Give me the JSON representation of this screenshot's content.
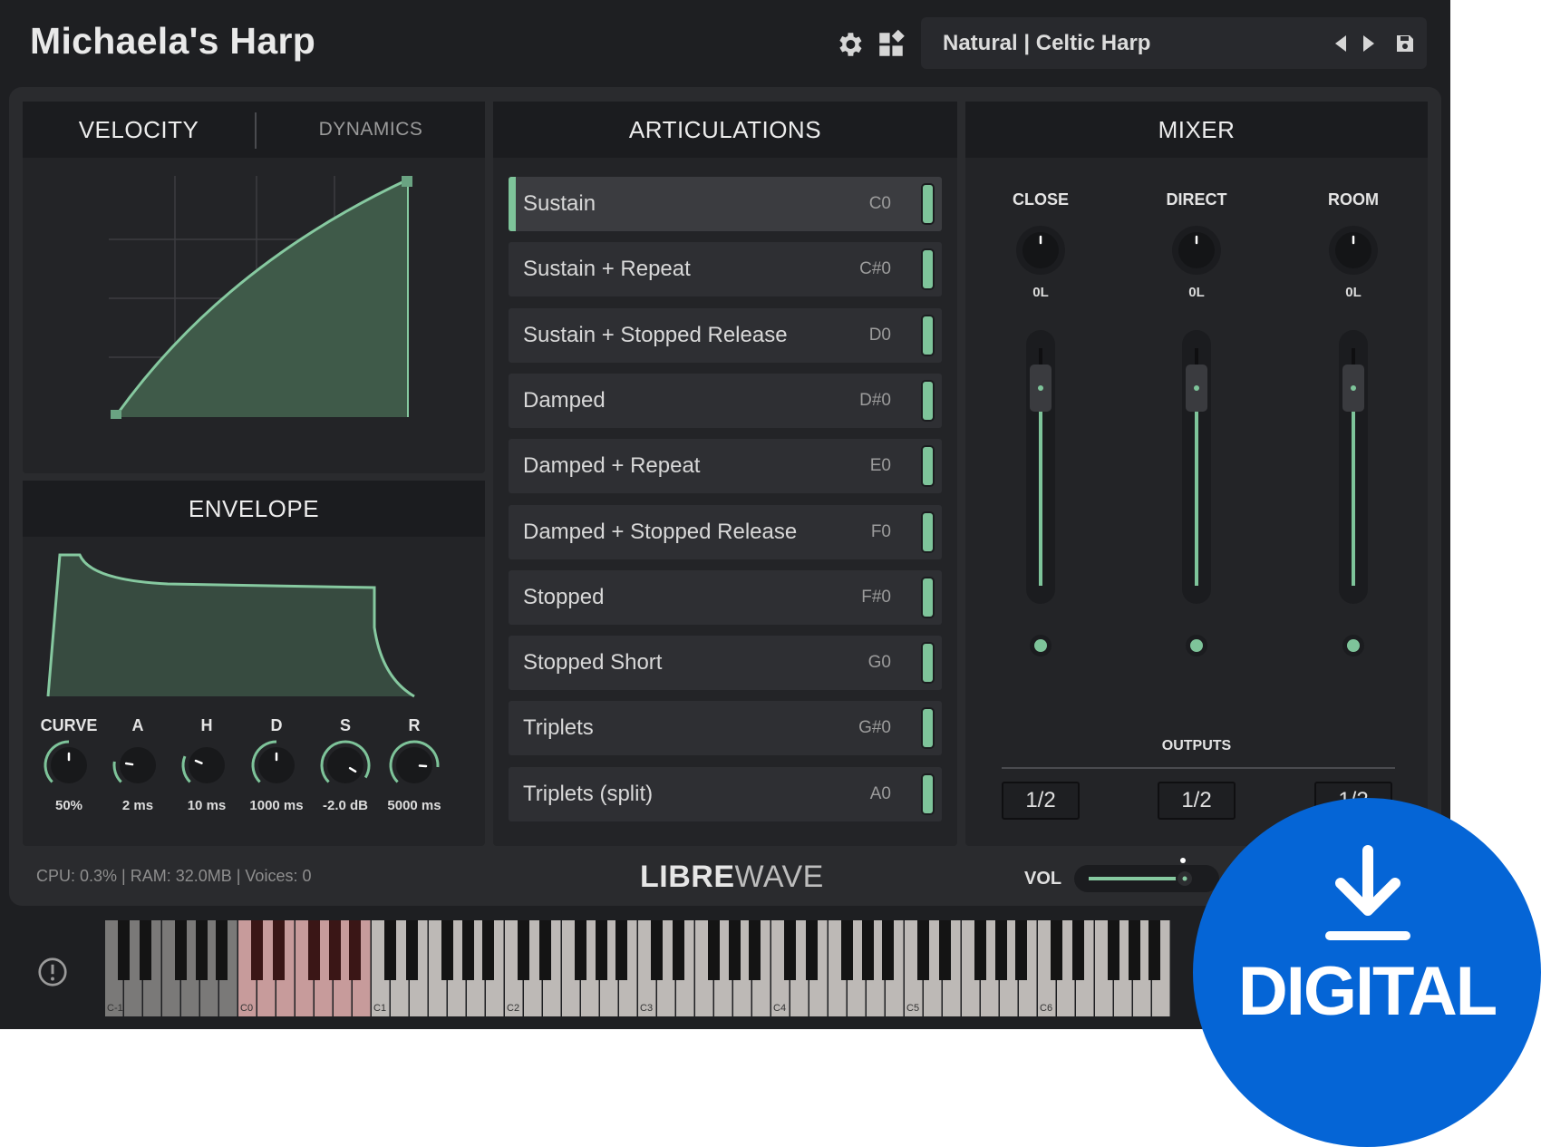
{
  "header": {
    "title": "Michaela's Harp",
    "preset": "Natural | Celtic Harp",
    "icons": [
      "gear-icon",
      "grid-icon",
      "prev-icon",
      "next-icon",
      "save-icon"
    ]
  },
  "velocity_panel": {
    "tab_active": "VELOCITY",
    "tab_inactive": "DYNAMICS"
  },
  "envelope_panel": {
    "title": "ENVELOPE",
    "knobs": [
      {
        "label": "CURVE",
        "value": "50%",
        "level": 0.5
      },
      {
        "label": "A",
        "value": "2 ms",
        "level": 0.2
      },
      {
        "label": "H",
        "value": "10 ms",
        "level": 0.25
      },
      {
        "label": "D",
        "value": "1000 ms",
        "level": 0.5
      },
      {
        "label": "S",
        "value": "-2.0 dB",
        "level": 0.95
      },
      {
        "label": "R",
        "value": "5000 ms",
        "level": 0.85
      }
    ]
  },
  "articulations_panel": {
    "title": "ARTICULATIONS",
    "items": [
      {
        "label": "Sustain",
        "note": "C0",
        "active": true
      },
      {
        "label": "Sustain + Repeat",
        "note": "C#0"
      },
      {
        "label": "Sustain + Stopped Release",
        "note": "D0"
      },
      {
        "label": "Damped",
        "note": "D#0"
      },
      {
        "label": "Damped + Repeat",
        "note": "E0"
      },
      {
        "label": "Damped + Stopped Release",
        "note": "F0"
      },
      {
        "label": "Stopped",
        "note": "F#0"
      },
      {
        "label": "Stopped Short",
        "note": "G0"
      },
      {
        "label": "Triplets",
        "note": "G#0"
      },
      {
        "label": "Triplets (split)",
        "note": "A0"
      }
    ]
  },
  "mixer_panel": {
    "title": "MIXER",
    "channels": [
      {
        "label": "CLOSE",
        "pan": "0L",
        "output": "1/2"
      },
      {
        "label": "DIRECT",
        "pan": "0L",
        "output": "1/2"
      },
      {
        "label": "ROOM",
        "pan": "0L",
        "output": "1/2"
      }
    ],
    "outputs_label": "OUTPUTS"
  },
  "footer": {
    "status": "CPU: 0.3% | RAM: 32.0MB | Voices: 0",
    "logo_bold": "LIBRE",
    "logo_light": "WAVE",
    "vol_label": "VOL"
  },
  "keyboard": {
    "octave_labels": [
      "C-1",
      "C0",
      "C1",
      "C2",
      "C3",
      "C4",
      "C5",
      "C6"
    ]
  },
  "badge": {
    "text": "DIGITAL"
  },
  "colors": {
    "accent_green": "#7ec49a",
    "badge_blue": "#0565d6",
    "keyswitch_red": "#c79b9b"
  }
}
